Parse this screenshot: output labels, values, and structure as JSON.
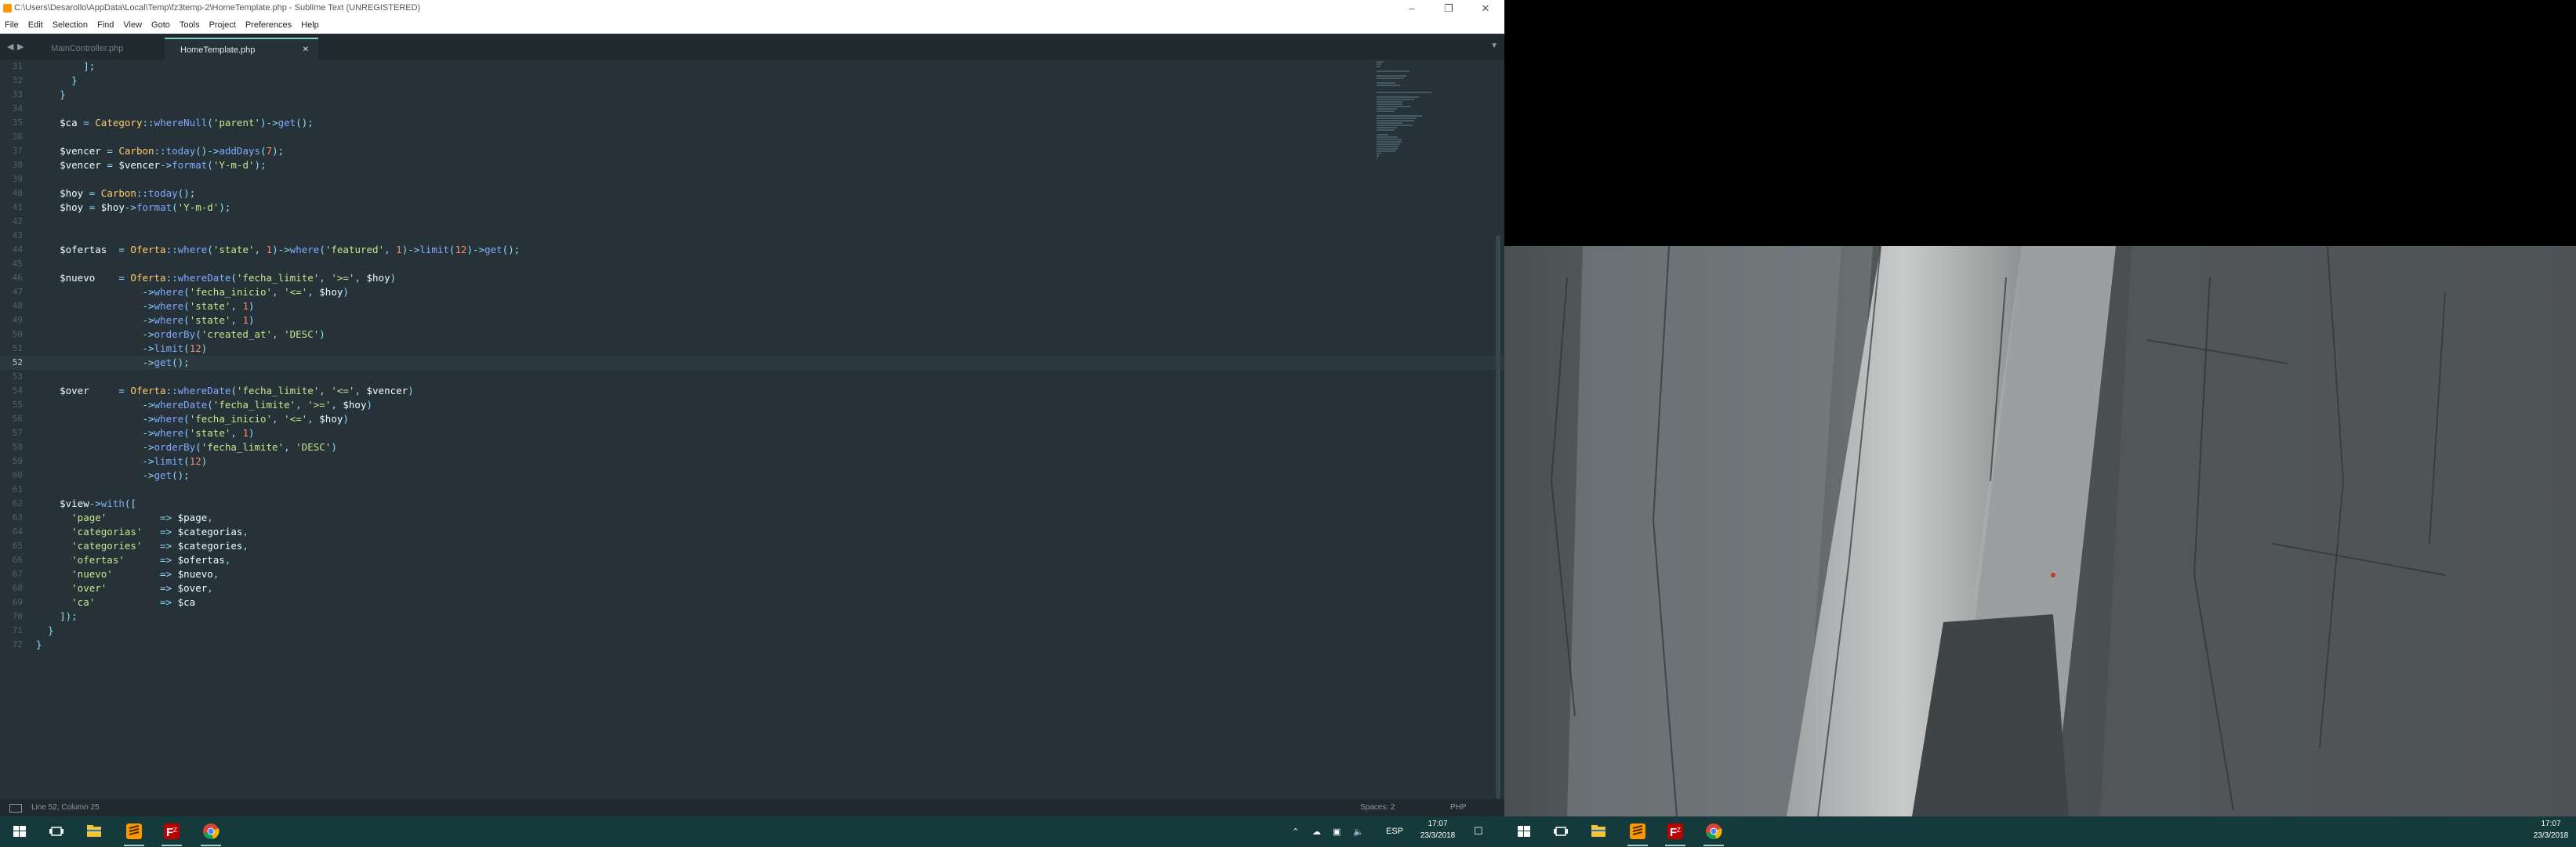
{
  "window": {
    "title": "C:\\Users\\Desarollo\\AppData\\Local\\Temp\\fz3temp-2\\HomeTemplate.php - Sublime Text (UNREGISTERED)"
  },
  "menu": [
    "File",
    "Edit",
    "Selection",
    "Find",
    "View",
    "Goto",
    "Tools",
    "Project",
    "Preferences",
    "Help"
  ],
  "tabs": [
    {
      "label": "MainController.php",
      "active": false
    },
    {
      "label": "HomeTemplate.php",
      "active": true
    }
  ],
  "editor": {
    "current_line": 52,
    "lines": [
      {
        "n": 31,
        "t": [
          [
            "        ];",
            "pun"
          ]
        ]
      },
      {
        "n": 32,
        "t": [
          [
            "      }",
            "pun"
          ]
        ]
      },
      {
        "n": 33,
        "t": [
          [
            "    }",
            "pun"
          ]
        ]
      },
      {
        "n": 34,
        "t": []
      },
      {
        "n": 35,
        "t": [
          [
            "    $ca",
            "var"
          ],
          [
            " = ",
            "op"
          ],
          [
            "Category",
            "cls"
          ],
          [
            "::",
            "op"
          ],
          [
            "whereNull",
            "fn"
          ],
          [
            "(",
            "pun"
          ],
          [
            "'parent'",
            "str"
          ],
          [
            ")->",
            "pun"
          ],
          [
            "get",
            "fn"
          ],
          [
            "();",
            "pun"
          ]
        ]
      },
      {
        "n": 36,
        "t": []
      },
      {
        "n": 37,
        "t": [
          [
            "    $vencer",
            "var"
          ],
          [
            " = ",
            "op"
          ],
          [
            "Carbon",
            "cls"
          ],
          [
            "::",
            "op"
          ],
          [
            "today",
            "fn"
          ],
          [
            "()->",
            "pun"
          ],
          [
            "addDays",
            "fn"
          ],
          [
            "(",
            "pun"
          ],
          [
            "7",
            "num"
          ],
          [
            ");",
            "pun"
          ]
        ]
      },
      {
        "n": 38,
        "t": [
          [
            "    $vencer",
            "var"
          ],
          [
            " = ",
            "op"
          ],
          [
            "$vencer",
            "var"
          ],
          [
            "->",
            "pun"
          ],
          [
            "format",
            "fn"
          ],
          [
            "(",
            "pun"
          ],
          [
            "'Y-m-d'",
            "str"
          ],
          [
            ");",
            "pun"
          ]
        ]
      },
      {
        "n": 39,
        "t": []
      },
      {
        "n": 40,
        "t": [
          [
            "    $hoy",
            "var"
          ],
          [
            " = ",
            "op"
          ],
          [
            "Carbon",
            "cls"
          ],
          [
            "::",
            "op"
          ],
          [
            "today",
            "fn"
          ],
          [
            "();",
            "pun"
          ]
        ]
      },
      {
        "n": 41,
        "t": [
          [
            "    $hoy",
            "var"
          ],
          [
            " = ",
            "op"
          ],
          [
            "$hoy",
            "var"
          ],
          [
            "->",
            "pun"
          ],
          [
            "format",
            "fn"
          ],
          [
            "(",
            "pun"
          ],
          [
            "'Y-m-d'",
            "str"
          ],
          [
            ");",
            "pun"
          ]
        ]
      },
      {
        "n": 42,
        "t": []
      },
      {
        "n": 43,
        "t": []
      },
      {
        "n": 44,
        "t": [
          [
            "    $ofertas",
            "var"
          ],
          [
            "  = ",
            "op"
          ],
          [
            "Oferta",
            "cls"
          ],
          [
            "::",
            "op"
          ],
          [
            "where",
            "fn"
          ],
          [
            "(",
            "pun"
          ],
          [
            "'state'",
            "str"
          ],
          [
            ", ",
            "pun"
          ],
          [
            "1",
            "num"
          ],
          [
            ")->",
            "pun"
          ],
          [
            "where",
            "fn"
          ],
          [
            "(",
            "pun"
          ],
          [
            "'featured'",
            "str"
          ],
          [
            ", ",
            "pun"
          ],
          [
            "1",
            "num"
          ],
          [
            ")->",
            "pun"
          ],
          [
            "limit",
            "fn"
          ],
          [
            "(",
            "pun"
          ],
          [
            "12",
            "num"
          ],
          [
            ")->",
            "pun"
          ],
          [
            "get",
            "fn"
          ],
          [
            "();",
            "pun"
          ]
        ]
      },
      {
        "n": 45,
        "t": []
      },
      {
        "n": 46,
        "t": [
          [
            "    $nuevo",
            "var"
          ],
          [
            "    = ",
            "op"
          ],
          [
            "Oferta",
            "cls"
          ],
          [
            "::",
            "op"
          ],
          [
            "whereDate",
            "fn"
          ],
          [
            "(",
            "pun"
          ],
          [
            "'fecha_limite'",
            "str"
          ],
          [
            ", ",
            "pun"
          ],
          [
            "'>='",
            "str"
          ],
          [
            ", ",
            "pun"
          ],
          [
            "$hoy",
            "var"
          ],
          [
            ")",
            "pun"
          ]
        ]
      },
      {
        "n": 47,
        "t": [
          [
            "                  ->",
            "pun"
          ],
          [
            "where",
            "fn"
          ],
          [
            "(",
            "pun"
          ],
          [
            "'fecha_inicio'",
            "str"
          ],
          [
            ", ",
            "pun"
          ],
          [
            "'<='",
            "str"
          ],
          [
            ", ",
            "pun"
          ],
          [
            "$hoy",
            "var"
          ],
          [
            ")",
            "pun"
          ]
        ]
      },
      {
        "n": 48,
        "t": [
          [
            "                  ->",
            "pun"
          ],
          [
            "where",
            "fn"
          ],
          [
            "(",
            "pun"
          ],
          [
            "'state'",
            "str"
          ],
          [
            ", ",
            "pun"
          ],
          [
            "1",
            "num"
          ],
          [
            ")",
            "pun"
          ]
        ]
      },
      {
        "n": 49,
        "t": [
          [
            "                  ->",
            "pun"
          ],
          [
            "where",
            "fn"
          ],
          [
            "(",
            "pun"
          ],
          [
            "'state'",
            "str"
          ],
          [
            ", ",
            "pun"
          ],
          [
            "1",
            "num"
          ],
          [
            ")",
            "pun"
          ]
        ]
      },
      {
        "n": 50,
        "t": [
          [
            "                  ->",
            "pun"
          ],
          [
            "orderBy",
            "fn"
          ],
          [
            "(",
            "pun"
          ],
          [
            "'created_at'",
            "str"
          ],
          [
            ", ",
            "pun"
          ],
          [
            "'DESC'",
            "str"
          ],
          [
            ")",
            "pun"
          ]
        ]
      },
      {
        "n": 51,
        "t": [
          [
            "                  ->",
            "pun"
          ],
          [
            "limit",
            "fn"
          ],
          [
            "(",
            "pun"
          ],
          [
            "12",
            "num"
          ],
          [
            ")",
            "pun"
          ]
        ]
      },
      {
        "n": 52,
        "t": [
          [
            "                  ->",
            "pun"
          ],
          [
            "get",
            "fn"
          ],
          [
            "();",
            "pun"
          ]
        ]
      },
      {
        "n": 53,
        "t": []
      },
      {
        "n": 54,
        "t": [
          [
            "    $over",
            "var"
          ],
          [
            "     = ",
            "op"
          ],
          [
            "Oferta",
            "cls"
          ],
          [
            "::",
            "op"
          ],
          [
            "whereDate",
            "fn"
          ],
          [
            "(",
            "pun"
          ],
          [
            "'fecha_limite'",
            "str"
          ],
          [
            ", ",
            "pun"
          ],
          [
            "'<='",
            "str"
          ],
          [
            ", ",
            "pun"
          ],
          [
            "$vencer",
            "var"
          ],
          [
            ")",
            "pun"
          ]
        ]
      },
      {
        "n": 55,
        "t": [
          [
            "                  ->",
            "pun"
          ],
          [
            "whereDate",
            "fn"
          ],
          [
            "(",
            "pun"
          ],
          [
            "'fecha_limite'",
            "str"
          ],
          [
            ", ",
            "pun"
          ],
          [
            "'>='",
            "str"
          ],
          [
            ", ",
            "pun"
          ],
          [
            "$hoy",
            "var"
          ],
          [
            ")",
            "pun"
          ]
        ]
      },
      {
        "n": 56,
        "t": [
          [
            "                  ->",
            "pun"
          ],
          [
            "where",
            "fn"
          ],
          [
            "(",
            "pun"
          ],
          [
            "'fecha_inicio'",
            "str"
          ],
          [
            ", ",
            "pun"
          ],
          [
            "'<='",
            "str"
          ],
          [
            ", ",
            "pun"
          ],
          [
            "$hoy",
            "var"
          ],
          [
            ")",
            "pun"
          ]
        ]
      },
      {
        "n": 57,
        "t": [
          [
            "                  ->",
            "pun"
          ],
          [
            "where",
            "fn"
          ],
          [
            "(",
            "pun"
          ],
          [
            "'state'",
            "str"
          ],
          [
            ", ",
            "pun"
          ],
          [
            "1",
            "num"
          ],
          [
            ")",
            "pun"
          ]
        ]
      },
      {
        "n": 58,
        "t": [
          [
            "                  ->",
            "pun"
          ],
          [
            "orderBy",
            "fn"
          ],
          [
            "(",
            "pun"
          ],
          [
            "'fecha_limite'",
            "str"
          ],
          [
            ", ",
            "pun"
          ],
          [
            "'DESC'",
            "str"
          ],
          [
            ")",
            "pun"
          ]
        ]
      },
      {
        "n": 59,
        "t": [
          [
            "                  ->",
            "pun"
          ],
          [
            "limit",
            "fn"
          ],
          [
            "(",
            "pun"
          ],
          [
            "12",
            "num"
          ],
          [
            ")",
            "pun"
          ]
        ]
      },
      {
        "n": 60,
        "t": [
          [
            "                  ->",
            "pun"
          ],
          [
            "get",
            "fn"
          ],
          [
            "();",
            "pun"
          ]
        ]
      },
      {
        "n": 61,
        "t": []
      },
      {
        "n": 62,
        "t": [
          [
            "    $view",
            "var"
          ],
          [
            "->",
            "pun"
          ],
          [
            "with",
            "fn"
          ],
          [
            "([",
            "pun"
          ]
        ]
      },
      {
        "n": 63,
        "t": [
          [
            "      'page'",
            "str"
          ],
          [
            "         => ",
            "op"
          ],
          [
            "$page",
            "var"
          ],
          [
            ",",
            "pun"
          ]
        ]
      },
      {
        "n": 64,
        "t": [
          [
            "      'categorias'",
            "str"
          ],
          [
            "   => ",
            "op"
          ],
          [
            "$categorias",
            "var"
          ],
          [
            ",",
            "pun"
          ]
        ]
      },
      {
        "n": 65,
        "t": [
          [
            "      'categories'",
            "str"
          ],
          [
            "   => ",
            "op"
          ],
          [
            "$categories",
            "var"
          ],
          [
            ",",
            "pun"
          ]
        ]
      },
      {
        "n": 66,
        "t": [
          [
            "      'ofertas'",
            "str"
          ],
          [
            "      => ",
            "op"
          ],
          [
            "$ofertas",
            "var"
          ],
          [
            ",",
            "pun"
          ]
        ]
      },
      {
        "n": 67,
        "t": [
          [
            "      'nuevo'",
            "str"
          ],
          [
            "        => ",
            "op"
          ],
          [
            "$nuevo",
            "var"
          ],
          [
            ",",
            "pun"
          ]
        ]
      },
      {
        "n": 68,
        "t": [
          [
            "      'over'",
            "str"
          ],
          [
            "         => ",
            "op"
          ],
          [
            "$over",
            "var"
          ],
          [
            ",",
            "pun"
          ]
        ]
      },
      {
        "n": 69,
        "t": [
          [
            "      'ca'",
            "str"
          ],
          [
            "           => ",
            "op"
          ],
          [
            "$ca",
            "var"
          ]
        ]
      },
      {
        "n": 70,
        "t": [
          [
            "    ]);",
            "pun"
          ]
        ]
      },
      {
        "n": 71,
        "t": [
          [
            "  }",
            "pun"
          ]
        ]
      },
      {
        "n": 72,
        "t": [
          [
            "}",
            "pun"
          ]
        ]
      }
    ]
  },
  "statusbar": {
    "position": "Line 52, Column 25",
    "spaces": "Spaces: 2",
    "syntax": "PHP"
  },
  "taskbar_left": {
    "lang": "ESP",
    "time": "17:07",
    "date": "23/3/2018"
  },
  "taskbar_right": {
    "time": "17:07",
    "date": "23/3/2018"
  },
  "colors": {
    "editor_bg": "#263238",
    "variable": "#eeffff",
    "class": "#ffcb6b",
    "function": "#82aaff",
    "string": "#c3e88d",
    "number": "#f78c6c",
    "punctuation": "#89ddff",
    "taskbar": "#143a3c"
  },
  "icons": [
    "app-icon",
    "minimize-icon",
    "maximize-icon",
    "close-icon",
    "start-icon",
    "task-view-icon",
    "file-explorer-icon",
    "sublime-icon",
    "filezilla-icon",
    "chrome-icon",
    "chevron-up-icon",
    "network-icon",
    "volume-icon",
    "notification-icon",
    "tab-dropdown-icon",
    "nav-left-icon",
    "nav-right-icon",
    "close-tab-icon"
  ]
}
